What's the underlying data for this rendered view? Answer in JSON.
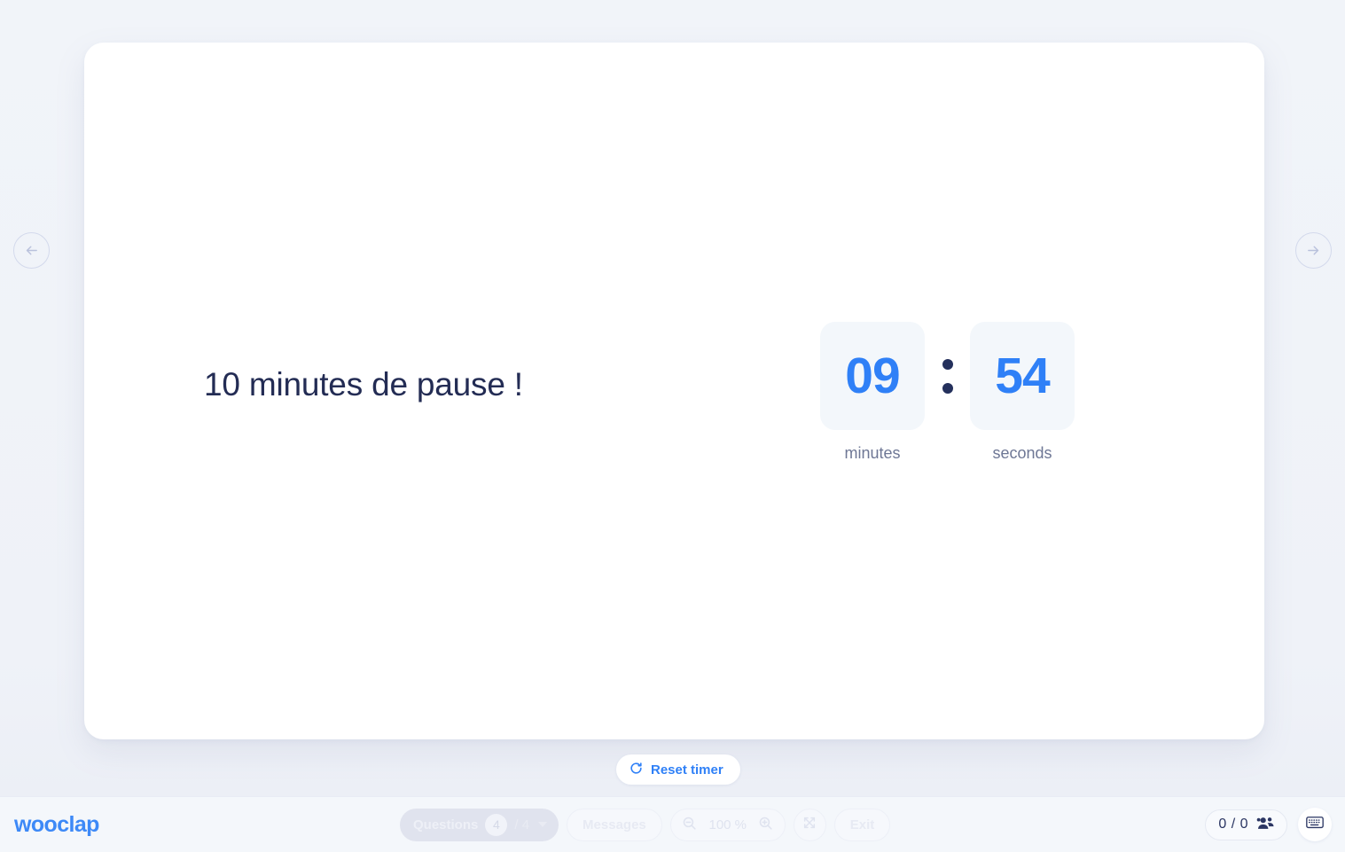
{
  "slide": {
    "title": "10 minutes de pause !"
  },
  "timer": {
    "minutes_value": "09",
    "seconds_value": "54",
    "minutes_label": "minutes",
    "seconds_label": "seconds",
    "separator": ":",
    "digit_color": "#2f80f7",
    "box_color": "#f3f7fb"
  },
  "reset_button": {
    "label": "Reset timer",
    "icon": "refresh-icon",
    "color": "#2f80f7"
  },
  "navigation": {
    "previous_icon": "arrow-left-icon",
    "next_icon": "arrow-right-icon"
  },
  "bottom_bar": {
    "logo": "wooclap",
    "logo_color": "#3d89f7",
    "questions": {
      "label": "Questions",
      "current": "4",
      "separator": "/",
      "total": "4",
      "caret_icon": "chevron-down-icon"
    },
    "messages": {
      "label": "Messages"
    },
    "zoom": {
      "out_icon": "zoom-out-icon",
      "value": "100 %",
      "in_icon": "zoom-in-icon"
    },
    "fullscreen": {
      "icon": "fullscreen-icon"
    },
    "exit": {
      "label": "Exit"
    },
    "participants": {
      "count": "0 / 0",
      "icon": "people-icon"
    },
    "keyboard": {
      "icon": "keyboard-icon"
    }
  }
}
